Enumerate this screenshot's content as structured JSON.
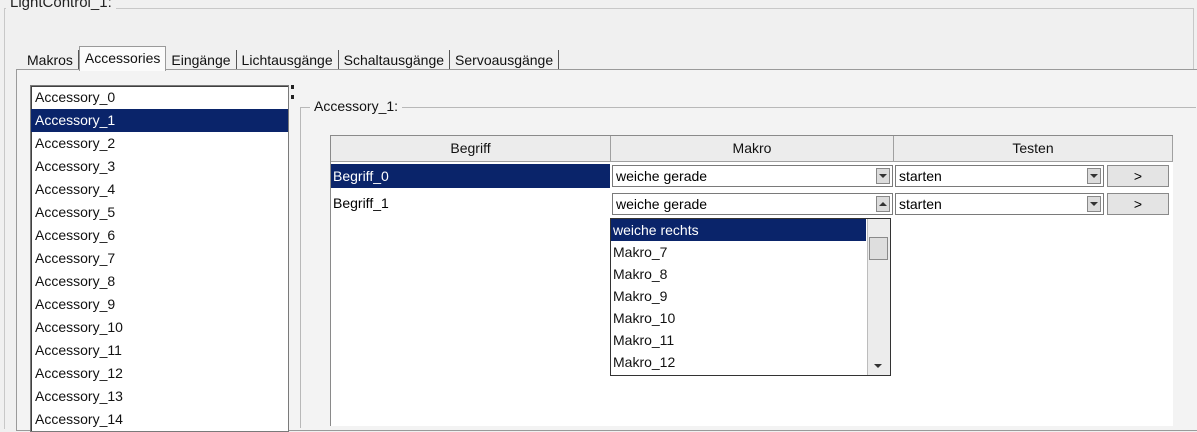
{
  "window": {
    "title": "LightControl_1:"
  },
  "tabs": [
    {
      "label": "Makros"
    },
    {
      "label": "Accessories"
    },
    {
      "label": "Eingänge"
    },
    {
      "label": "Lichtausgänge"
    },
    {
      "label": "Schaltausgänge"
    },
    {
      "label": "Servoausgänge"
    }
  ],
  "accessory_list": {
    "items": [
      "Accessory_0",
      "Accessory_1",
      "Accessory_2",
      "Accessory_3",
      "Accessory_4",
      "Accessory_5",
      "Accessory_6",
      "Accessory_7",
      "Accessory_8",
      "Accessory_9",
      "Accessory_10",
      "Accessory_11",
      "Accessory_12",
      "Accessory_13",
      "Accessory_14"
    ],
    "selected": "Accessory_1"
  },
  "group": {
    "title": "Accessory_1:"
  },
  "grid": {
    "headers": {
      "begriff": "Begriff",
      "makro": "Makro",
      "testen": "Testen"
    },
    "rows": [
      {
        "begriff": "Begriff_0",
        "makro": "weiche gerade",
        "testen": "starten",
        "button": ">"
      },
      {
        "begriff": "Begriff_1",
        "makro": "weiche gerade",
        "testen": "starten",
        "button": ">"
      }
    ]
  },
  "dropdown": {
    "options": [
      "weiche rechts",
      "Makro_7",
      "Makro_8",
      "Makro_9",
      "Makro_10",
      "Makro_11",
      "Makro_12"
    ],
    "highlighted": "weiche rechts"
  },
  "colors": {
    "selection": "#0a246a",
    "background": "#f0f0f0"
  }
}
